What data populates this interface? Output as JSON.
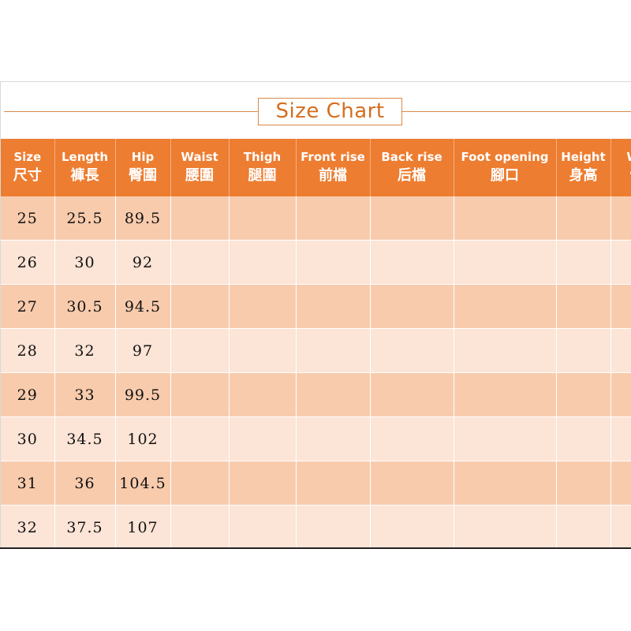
{
  "title": "Size Chart",
  "colors": {
    "header_bg": "#ed7d31",
    "row_odd": "#f8cbad",
    "row_even": "#fce4d6",
    "title_accent": "#d98a4a"
  },
  "columns": [
    {
      "en": "Size",
      "zh": "尺寸"
    },
    {
      "en": "Length",
      "zh": "褲長"
    },
    {
      "en": "Hip",
      "zh": "臀圍"
    },
    {
      "en": "Waist",
      "zh": "腰圍"
    },
    {
      "en": "Thigh",
      "zh": "腿圍"
    },
    {
      "en": "Front rise",
      "zh": "前檔"
    },
    {
      "en": "Back rise",
      "zh": "后檔"
    },
    {
      "en": "Foot opening",
      "zh": "腳口"
    },
    {
      "en": "Height",
      "zh": "身高"
    },
    {
      "en": "We",
      "zh": "體"
    }
  ],
  "rows": [
    [
      "25",
      "25.5",
      "89.5",
      "",
      "",
      "",
      "",
      "",
      "",
      ""
    ],
    [
      "26",
      "30",
      "92",
      "",
      "",
      "",
      "",
      "",
      "",
      ""
    ],
    [
      "27",
      "30.5",
      "94.5",
      "",
      "",
      "",
      "",
      "",
      "",
      ""
    ],
    [
      "28",
      "32",
      "97",
      "",
      "",
      "",
      "",
      "",
      "",
      ""
    ],
    [
      "29",
      "33",
      "99.5",
      "",
      "",
      "",
      "",
      "",
      "",
      ""
    ],
    [
      "30",
      "34.5",
      "102",
      "",
      "",
      "",
      "",
      "",
      "",
      ""
    ],
    [
      "31",
      "36",
      "104.5",
      "",
      "",
      "",
      "",
      "",
      "",
      ""
    ],
    [
      "32",
      "37.5",
      "107",
      "",
      "",
      "",
      "",
      "",
      "",
      ""
    ]
  ]
}
